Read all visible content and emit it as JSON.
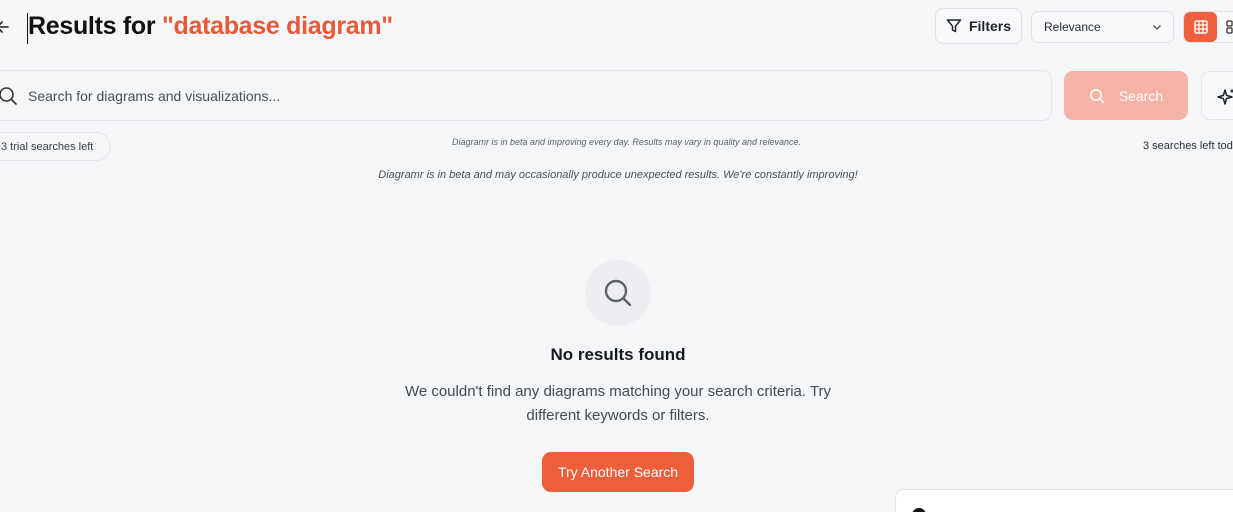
{
  "header": {
    "title_prefix": "Results for ",
    "query_display": "\"database diagram\"",
    "filters_label": "Filters",
    "sort_value": "Relevance",
    "accent_color": "#ee5f3d"
  },
  "search": {
    "placeholder": "Search for diagrams and visualizations...",
    "button_label": "Search"
  },
  "info": {
    "trial_searches": "3 trial searches left",
    "beta_note_small": "Diagramr is in beta and improving every day. Results may vary in quality and relevance.",
    "beta_note": "Diagramr is in beta and may occasionally produce unexpected results. We're constantly improving!",
    "searches_left": "3 searches left tod"
  },
  "empty_state": {
    "title": "No results found",
    "description": "We couldn't find any diagrams matching your search criteria. Try different keywords or filters.",
    "button_label": "Try Another Search"
  },
  "icons": {
    "back": "arrow-left-icon",
    "filter": "filter-icon",
    "sort": "chevron-down-icon",
    "grid_view": "grid-icon",
    "list_view": "layout-icon",
    "search": "search-icon",
    "magic": "sparkles-icon"
  }
}
